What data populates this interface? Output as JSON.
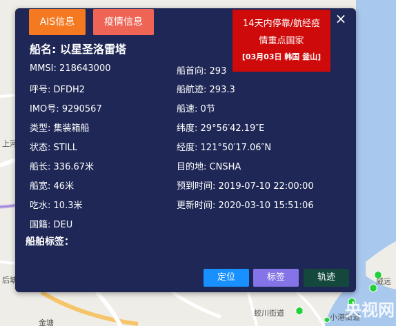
{
  "tabs": [
    {
      "label": "AIS信息"
    },
    {
      "label": "疫情信息"
    }
  ],
  "alert": {
    "line1": "14天内停靠/航经疫",
    "line2": "情重点国家",
    "line3": "[03月03日 韩国 釜山]"
  },
  "close_icon": "×",
  "ship_name": "船名: 以星圣洛雷塔",
  "left_fields": [
    {
      "key": "MMSI:",
      "value": "218643000"
    },
    {
      "key": "呼号:",
      "value": "DFDH2"
    },
    {
      "key": "IMO号:",
      "value": "9290567"
    },
    {
      "key": "类型:",
      "value": "集装箱船"
    },
    {
      "key": "状态:",
      "value": "STILL"
    },
    {
      "key": "船长:",
      "value": "336.67米"
    },
    {
      "key": "船宽:",
      "value": "46米"
    },
    {
      "key": "吃水:",
      "value": "10.3米"
    },
    {
      "key": "国籍:",
      "value": "DEU"
    }
  ],
  "right_fields": [
    {
      "key": "船首向:",
      "value": "293"
    },
    {
      "key": "船航迹:",
      "value": "293.3"
    },
    {
      "key": "船速:",
      "value": "0节"
    },
    {
      "key": "纬度:",
      "value": "29°56′42.19″E"
    },
    {
      "key": "经度:",
      "value": "121°50′17.06″N"
    },
    {
      "key": "目的地:",
      "value": "CNSHA"
    },
    {
      "key": "预到时间:",
      "value": "2019-07-10 22:00:00"
    },
    {
      "key": "更新时间:",
      "value": "2020-03-10 15:51:06"
    }
  ],
  "tags_label": "船舶标签：",
  "buttons": {
    "locate": "定位",
    "tag": "标签",
    "track": "轨迹"
  },
  "map_labels": {
    "a": "上河",
    "b": "后塘",
    "c": "蛟川街道",
    "d": "威远",
    "e": "小港街道",
    "f": "金塘",
    "g": "央视网"
  }
}
